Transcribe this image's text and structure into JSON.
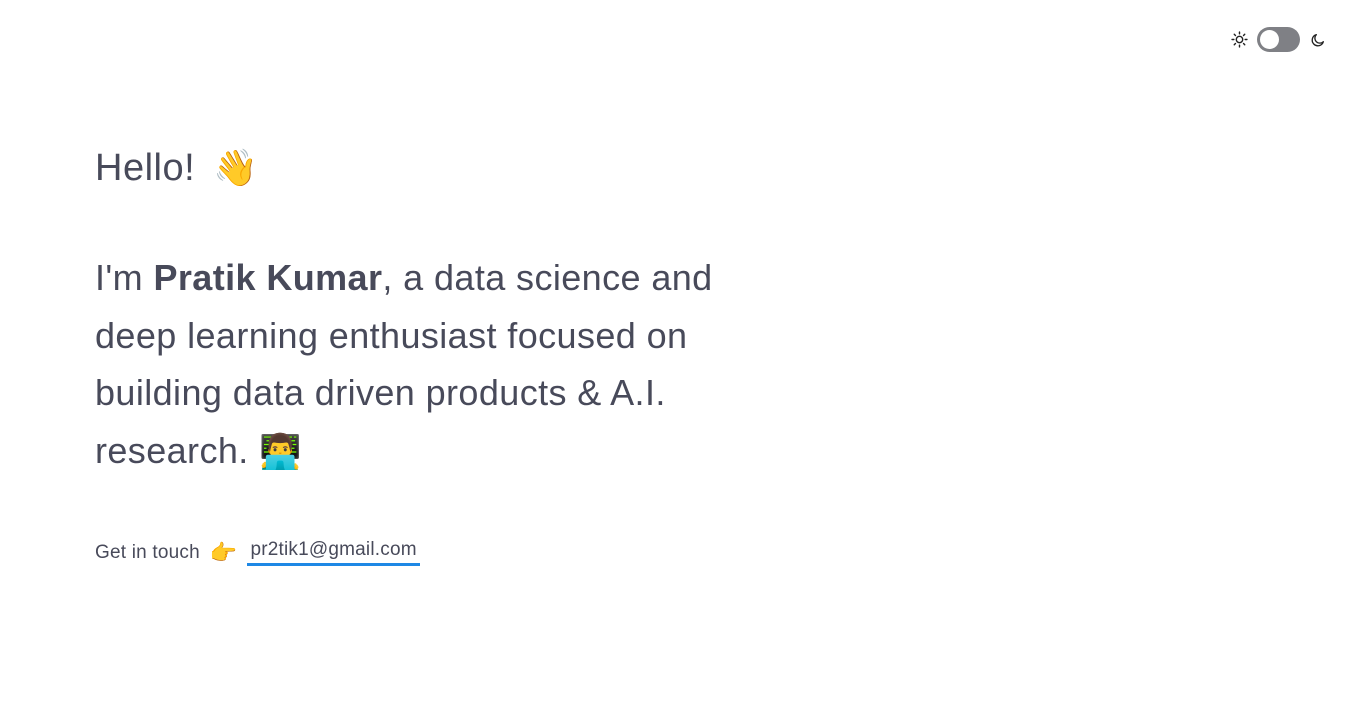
{
  "theme_toggle": {
    "light_icon": "sun-icon",
    "dark_icon": "moon-icon",
    "state": "light"
  },
  "hero": {
    "greeting": "Hello!",
    "greeting_emoji": "👋",
    "intro_prefix": "I'm ",
    "name": "Pratik Kumar",
    "intro_suffix": ", a data science and deep learning enthusiast focused on building data driven products & A.I. research.",
    "intro_emoji": "👨‍💻"
  },
  "contact": {
    "label": "Get in touch",
    "pointer_emoji": "👉",
    "email": "pr2tik1@gmail.com"
  },
  "colors": {
    "text": "#484a5a",
    "link_underline": "#1e88e5",
    "toggle_track": "#7f8085"
  }
}
